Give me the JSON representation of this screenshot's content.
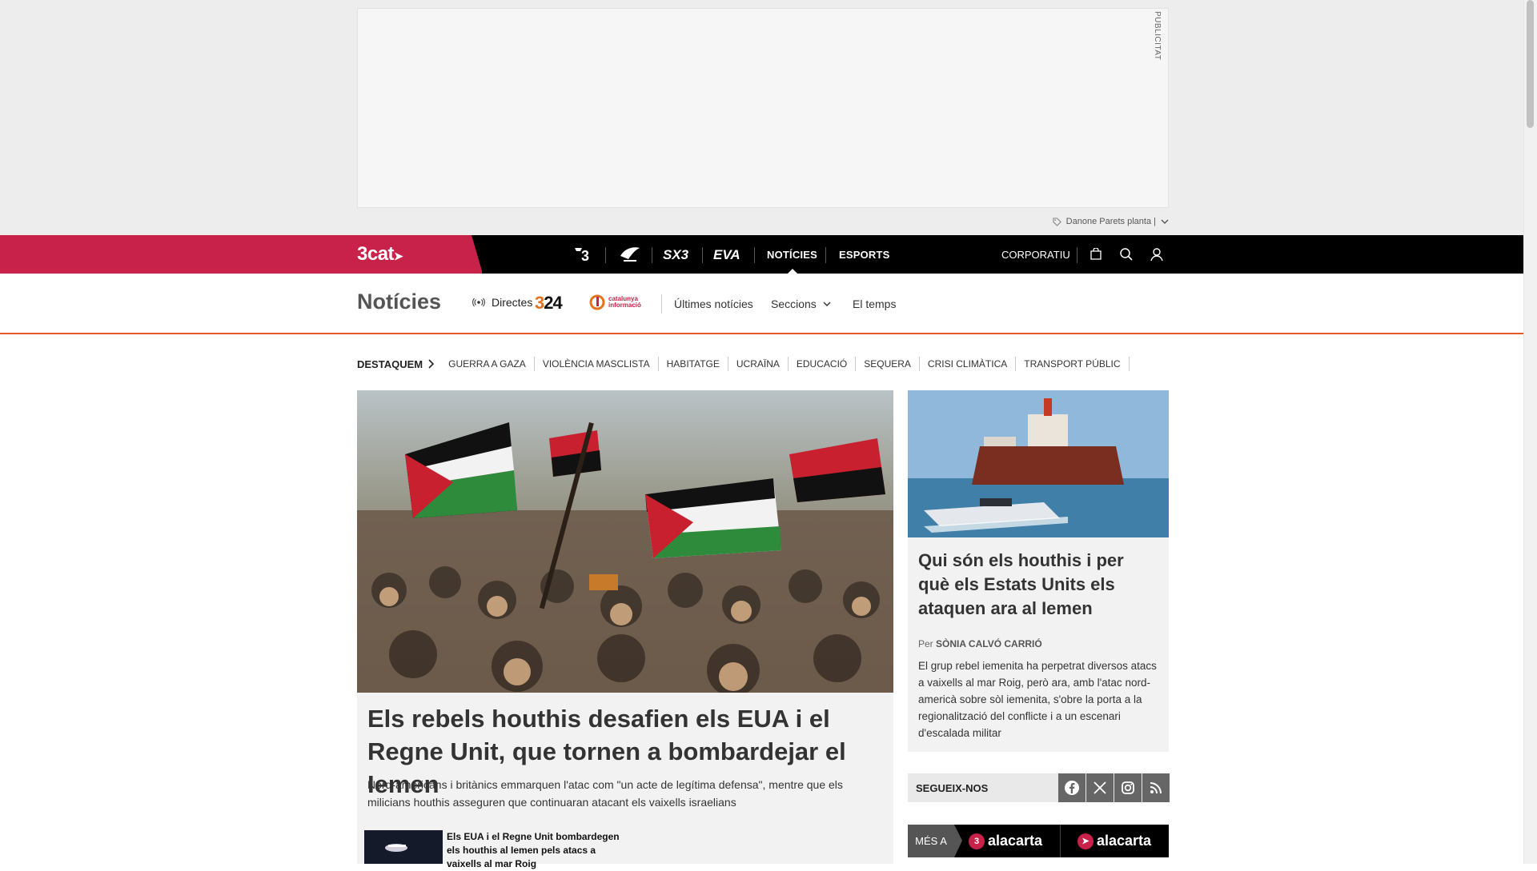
{
  "ad": {
    "label": "PUBLICITAT",
    "sponsor": "Danone Parets planta |"
  },
  "topnav": {
    "brand": "3cat",
    "channels": [
      "3",
      "Cat Ràdio",
      "SX3",
      "EVA"
    ],
    "links": [
      "NOTÍCIES",
      "ESPORTS"
    ],
    "active": "NOTÍCIES",
    "corporate": "CORPORATIU",
    "icons": [
      "shop-icon",
      "search-icon",
      "user-icon"
    ]
  },
  "section": {
    "title": "Notícies",
    "live": "Directes",
    "logo_324": "324",
    "logo_ci": "catalunya informació",
    "links": [
      "Últimes notícies",
      "Seccions",
      "El temps"
    ]
  },
  "tags": {
    "lead": "DESTAQUEM",
    "items": [
      "GUERRA A GAZA",
      "VIOLÈNCIA MASCLISTA",
      "HABITATGE",
      "UCRAÏNA",
      "EDUCACIÓ",
      "SEQUERA",
      "CRISI CLIMÀTICA",
      "TRANSPORT PÚBLIC"
    ]
  },
  "main_story": {
    "title": "Els rebels houthis desafien els EUA i el Regne Unit, que tornen a bombardejar el Iemen",
    "summary": "Nord-americans i britànics emmarquen l'atac com \"un acte de legítima defensa\", mentre que els milicians houthis asseguren que continuaran atacant els vaixells israelians",
    "related": "Els EUA i el Regne Unit bombardegen els houthis al Iemen pels atacs a vaixells al mar Roig"
  },
  "side_story": {
    "title": "Qui són els houthis i per què els Estats Units els ataquen ara al Iemen",
    "by_prefix": "Per",
    "author": "SÒNIA CALVÓ CARRIÓ",
    "summary": "El grup rebel iemenita ha perpetrat diversos atacs a vaixells al mar Roig, però ara, amb l'atac nord-americà sobre sòl iemenita, s'obre la porta a la regionalització del conflicte i a un escenari d'escalada militar"
  },
  "follow": {
    "label": "SEGUEIX-NOS",
    "networks": [
      "facebook-icon",
      "x-icon",
      "instagram-icon",
      "rss-icon"
    ]
  },
  "mesa": {
    "label": "MÉS A",
    "items": [
      "alacarta",
      "alacarta"
    ]
  },
  "colors": {
    "brand": "#c8224a",
    "accent": "#e65a2a"
  }
}
